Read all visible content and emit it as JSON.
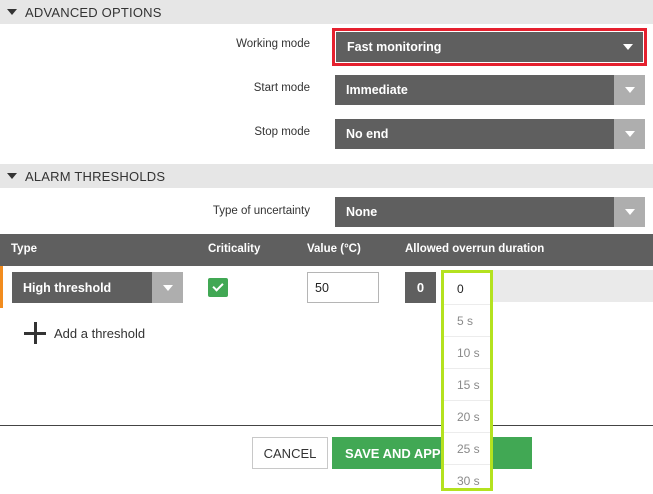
{
  "advanced_options": {
    "title": "ADVANCED OPTIONS",
    "working_mode": {
      "label": "Working mode",
      "value": "Fast monitoring"
    },
    "start_mode": {
      "label": "Start mode",
      "value": "Immediate"
    },
    "stop_mode": {
      "label": "Stop mode",
      "value": "No end"
    }
  },
  "alarm_thresholds": {
    "title": "ALARM THRESHOLDS",
    "uncertainty": {
      "label": "Type of uncertainty",
      "value": "None"
    },
    "columns": [
      "Type",
      "Criticality",
      "Value (°C)",
      "Allowed overrun duration"
    ],
    "row": {
      "type": "High threshold",
      "criticality_checked": true,
      "value": "50",
      "overrun_duration": "0"
    },
    "add_label": "Add a threshold"
  },
  "dropdown": {
    "options": [
      "0",
      "5 s",
      "10 s",
      "15 s",
      "20 s",
      "25 s",
      "30 s"
    ]
  },
  "footer": {
    "cancel_label": "CANCEL",
    "save_label": "SAVE AND APPLY"
  },
  "colors": {
    "highlight_red": "#e5202e",
    "highlight_green": "#b4e21f",
    "accent_green": "#41a854",
    "row_accent_orange": "#f28c1e"
  }
}
